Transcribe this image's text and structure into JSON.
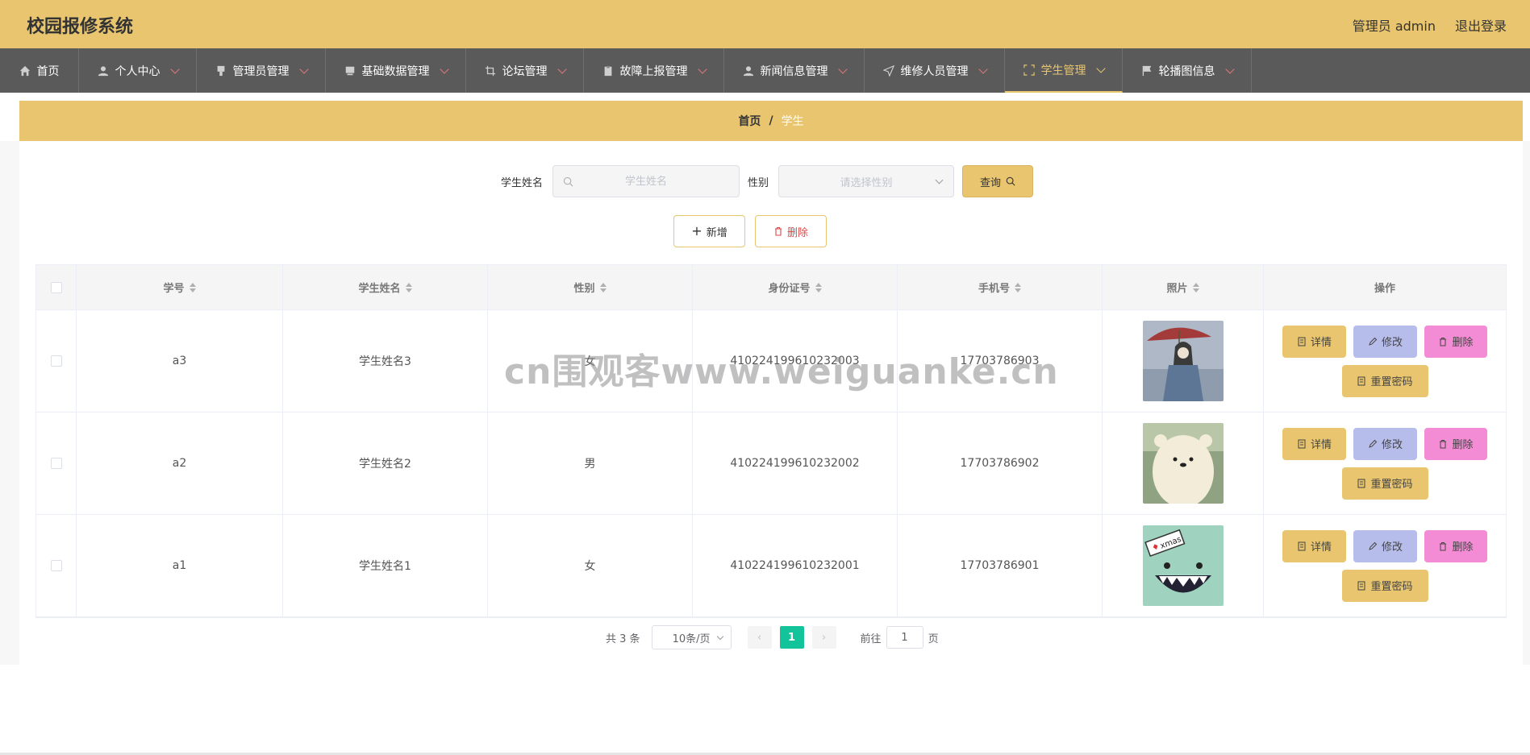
{
  "header": {
    "title": "校园报修系统",
    "user": "管理员 admin",
    "logout": "退出登录"
  },
  "nav": [
    {
      "label": "首页",
      "icon": "home-icon"
    },
    {
      "label": "个人中心",
      "icon": "user-icon"
    },
    {
      "label": "管理员管理",
      "icon": "stamp-icon"
    },
    {
      "label": "基础数据管理",
      "icon": "monitor-icon"
    },
    {
      "label": "论坛管理",
      "icon": "crop-icon"
    },
    {
      "label": "故障上报管理",
      "icon": "clipboard-icon"
    },
    {
      "label": "新闻信息管理",
      "icon": "user-icon"
    },
    {
      "label": "维修人员管理",
      "icon": "send-icon"
    },
    {
      "label": "学生管理",
      "icon": "fullscreen-icon"
    },
    {
      "label": "轮播图信息",
      "icon": "flag-icon"
    }
  ],
  "breadcrumb": {
    "home": "首页",
    "sep": "/",
    "current": "学生"
  },
  "search": {
    "name_label": "学生姓名",
    "name_placeholder": "学生姓名",
    "gender_label": "性别",
    "gender_placeholder": "请选择性别",
    "query_label": "查询"
  },
  "actions": {
    "add": "新增",
    "delete": "删除"
  },
  "table": {
    "headers": [
      "学号",
      "学生姓名",
      "性别",
      "身份证号",
      "手机号",
      "照片",
      "操作"
    ],
    "rows": [
      {
        "id": "a3",
        "name": "学生姓名3",
        "gender": "女",
        "idcard": "410224199610232003",
        "phone": "17703786903",
        "photo": "girl-umbrella-photo"
      },
      {
        "id": "a2",
        "name": "学生姓名2",
        "gender": "男",
        "idcard": "410224199610232002",
        "phone": "17703786902",
        "photo": "bear-photo"
      },
      {
        "id": "a1",
        "name": "学生姓名1",
        "gender": "女",
        "idcard": "410224199610232001",
        "phone": "17703786901",
        "photo": "monster-xmas-photo"
      }
    ],
    "ops": {
      "detail": "详情",
      "edit": "修改",
      "delete": "删除",
      "reset": "重置密码"
    }
  },
  "pager": {
    "total": "共 3 条",
    "page_size": "10条/页",
    "current": "1",
    "goto": "前往",
    "goto_value": "1",
    "suffix": "页"
  },
  "watermark": "cn围观客www.weiguanke.cn",
  "colors": {
    "accent": "#e8c56e",
    "nav_bg": "#5a5a5a",
    "page_active": "#13c39a",
    "danger": "#e04545",
    "edit": "#b7bdea",
    "delete": "#f38bd5"
  }
}
